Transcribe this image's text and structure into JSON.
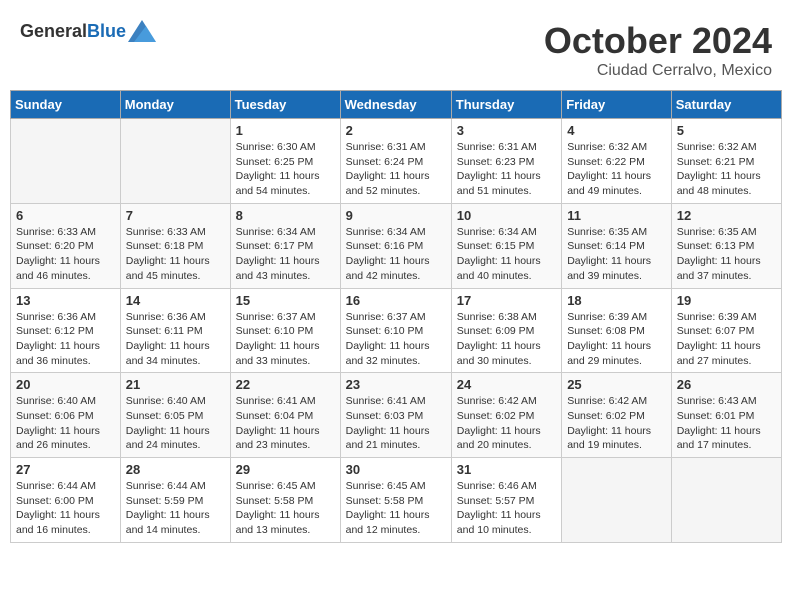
{
  "header": {
    "logo_general": "General",
    "logo_blue": "Blue",
    "month": "October 2024",
    "location": "Ciudad Cerralvo, Mexico"
  },
  "days_of_week": [
    "Sunday",
    "Monday",
    "Tuesday",
    "Wednesday",
    "Thursday",
    "Friday",
    "Saturday"
  ],
  "weeks": [
    [
      {
        "day": "",
        "sunrise": "",
        "sunset": "",
        "daylight": "",
        "empty": true
      },
      {
        "day": "",
        "sunrise": "",
        "sunset": "",
        "daylight": "",
        "empty": true
      },
      {
        "day": "1",
        "sunrise": "Sunrise: 6:30 AM",
        "sunset": "Sunset: 6:25 PM",
        "daylight": "Daylight: 11 hours and 54 minutes."
      },
      {
        "day": "2",
        "sunrise": "Sunrise: 6:31 AM",
        "sunset": "Sunset: 6:24 PM",
        "daylight": "Daylight: 11 hours and 52 minutes."
      },
      {
        "day": "3",
        "sunrise": "Sunrise: 6:31 AM",
        "sunset": "Sunset: 6:23 PM",
        "daylight": "Daylight: 11 hours and 51 minutes."
      },
      {
        "day": "4",
        "sunrise": "Sunrise: 6:32 AM",
        "sunset": "Sunset: 6:22 PM",
        "daylight": "Daylight: 11 hours and 49 minutes."
      },
      {
        "day": "5",
        "sunrise": "Sunrise: 6:32 AM",
        "sunset": "Sunset: 6:21 PM",
        "daylight": "Daylight: 11 hours and 48 minutes."
      }
    ],
    [
      {
        "day": "6",
        "sunrise": "Sunrise: 6:33 AM",
        "sunset": "Sunset: 6:20 PM",
        "daylight": "Daylight: 11 hours and 46 minutes."
      },
      {
        "day": "7",
        "sunrise": "Sunrise: 6:33 AM",
        "sunset": "Sunset: 6:18 PM",
        "daylight": "Daylight: 11 hours and 45 minutes."
      },
      {
        "day": "8",
        "sunrise": "Sunrise: 6:34 AM",
        "sunset": "Sunset: 6:17 PM",
        "daylight": "Daylight: 11 hours and 43 minutes."
      },
      {
        "day": "9",
        "sunrise": "Sunrise: 6:34 AM",
        "sunset": "Sunset: 6:16 PM",
        "daylight": "Daylight: 11 hours and 42 minutes."
      },
      {
        "day": "10",
        "sunrise": "Sunrise: 6:34 AM",
        "sunset": "Sunset: 6:15 PM",
        "daylight": "Daylight: 11 hours and 40 minutes."
      },
      {
        "day": "11",
        "sunrise": "Sunrise: 6:35 AM",
        "sunset": "Sunset: 6:14 PM",
        "daylight": "Daylight: 11 hours and 39 minutes."
      },
      {
        "day": "12",
        "sunrise": "Sunrise: 6:35 AM",
        "sunset": "Sunset: 6:13 PM",
        "daylight": "Daylight: 11 hours and 37 minutes."
      }
    ],
    [
      {
        "day": "13",
        "sunrise": "Sunrise: 6:36 AM",
        "sunset": "Sunset: 6:12 PM",
        "daylight": "Daylight: 11 hours and 36 minutes."
      },
      {
        "day": "14",
        "sunrise": "Sunrise: 6:36 AM",
        "sunset": "Sunset: 6:11 PM",
        "daylight": "Daylight: 11 hours and 34 minutes."
      },
      {
        "day": "15",
        "sunrise": "Sunrise: 6:37 AM",
        "sunset": "Sunset: 6:10 PM",
        "daylight": "Daylight: 11 hours and 33 minutes."
      },
      {
        "day": "16",
        "sunrise": "Sunrise: 6:37 AM",
        "sunset": "Sunset: 6:10 PM",
        "daylight": "Daylight: 11 hours and 32 minutes."
      },
      {
        "day": "17",
        "sunrise": "Sunrise: 6:38 AM",
        "sunset": "Sunset: 6:09 PM",
        "daylight": "Daylight: 11 hours and 30 minutes."
      },
      {
        "day": "18",
        "sunrise": "Sunrise: 6:39 AM",
        "sunset": "Sunset: 6:08 PM",
        "daylight": "Daylight: 11 hours and 29 minutes."
      },
      {
        "day": "19",
        "sunrise": "Sunrise: 6:39 AM",
        "sunset": "Sunset: 6:07 PM",
        "daylight": "Daylight: 11 hours and 27 minutes."
      }
    ],
    [
      {
        "day": "20",
        "sunrise": "Sunrise: 6:40 AM",
        "sunset": "Sunset: 6:06 PM",
        "daylight": "Daylight: 11 hours and 26 minutes."
      },
      {
        "day": "21",
        "sunrise": "Sunrise: 6:40 AM",
        "sunset": "Sunset: 6:05 PM",
        "daylight": "Daylight: 11 hours and 24 minutes."
      },
      {
        "day": "22",
        "sunrise": "Sunrise: 6:41 AM",
        "sunset": "Sunset: 6:04 PM",
        "daylight": "Daylight: 11 hours and 23 minutes."
      },
      {
        "day": "23",
        "sunrise": "Sunrise: 6:41 AM",
        "sunset": "Sunset: 6:03 PM",
        "daylight": "Daylight: 11 hours and 21 minutes."
      },
      {
        "day": "24",
        "sunrise": "Sunrise: 6:42 AM",
        "sunset": "Sunset: 6:02 PM",
        "daylight": "Daylight: 11 hours and 20 minutes."
      },
      {
        "day": "25",
        "sunrise": "Sunrise: 6:42 AM",
        "sunset": "Sunset: 6:02 PM",
        "daylight": "Daylight: 11 hours and 19 minutes."
      },
      {
        "day": "26",
        "sunrise": "Sunrise: 6:43 AM",
        "sunset": "Sunset: 6:01 PM",
        "daylight": "Daylight: 11 hours and 17 minutes."
      }
    ],
    [
      {
        "day": "27",
        "sunrise": "Sunrise: 6:44 AM",
        "sunset": "Sunset: 6:00 PM",
        "daylight": "Daylight: 11 hours and 16 minutes."
      },
      {
        "day": "28",
        "sunrise": "Sunrise: 6:44 AM",
        "sunset": "Sunset: 5:59 PM",
        "daylight": "Daylight: 11 hours and 14 minutes."
      },
      {
        "day": "29",
        "sunrise": "Sunrise: 6:45 AM",
        "sunset": "Sunset: 5:58 PM",
        "daylight": "Daylight: 11 hours and 13 minutes."
      },
      {
        "day": "30",
        "sunrise": "Sunrise: 6:45 AM",
        "sunset": "Sunset: 5:58 PM",
        "daylight": "Daylight: 11 hours and 12 minutes."
      },
      {
        "day": "31",
        "sunrise": "Sunrise: 6:46 AM",
        "sunset": "Sunset: 5:57 PM",
        "daylight": "Daylight: 11 hours and 10 minutes."
      },
      {
        "day": "",
        "sunrise": "",
        "sunset": "",
        "daylight": "",
        "empty": true
      },
      {
        "day": "",
        "sunrise": "",
        "sunset": "",
        "daylight": "",
        "empty": true
      }
    ]
  ]
}
